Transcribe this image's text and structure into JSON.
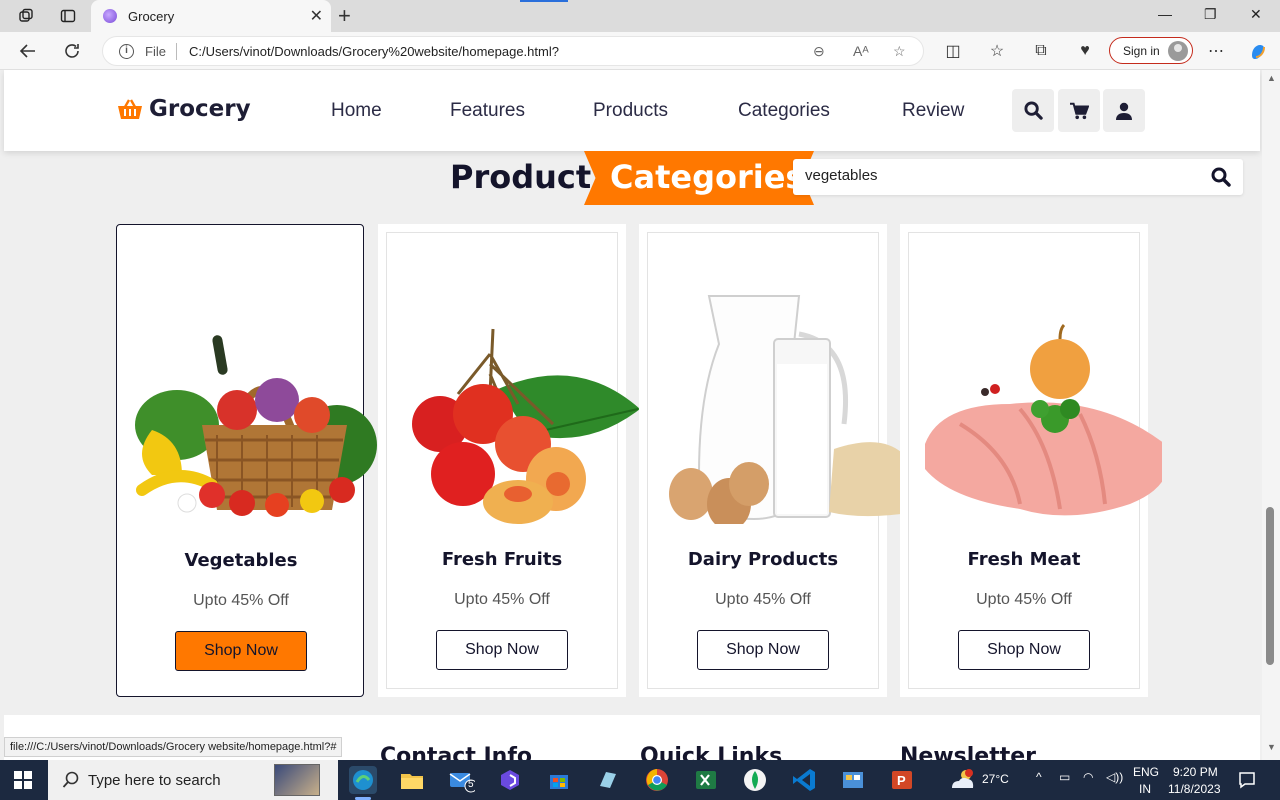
{
  "browser": {
    "tab_title": "Grocery",
    "address_scheme": "File",
    "address_url": "C:/Users/vinot/Downloads/Grocery%20website/homepage.html?",
    "signin_label": "Sign in",
    "status_url": "file:///C:/Users/vinot/Downloads/Grocery website/homepage.html?#"
  },
  "site": {
    "logo_text": "Grocery",
    "nav": [
      "Home",
      "Features",
      "Products",
      "Categories",
      "Review"
    ],
    "section_title_1": "Product",
    "section_title_2": "Categories",
    "search_value": "vegetables",
    "categories": [
      {
        "title": "Vegetables",
        "offer": "Upto 45% Off",
        "button": "Shop Now",
        "active": true
      },
      {
        "title": "Fresh Fruits",
        "offer": "Upto 45% Off",
        "button": "Shop Now",
        "active": false
      },
      {
        "title": "Dairy Products",
        "offer": "Upto 45% Off",
        "button": "Shop Now",
        "active": false
      },
      {
        "title": "Fresh Meat",
        "offer": "Upto 45% Off",
        "button": "Shop Now",
        "active": false
      }
    ],
    "footer_headings": [
      "Contact Info",
      "Quick Links",
      "Newsletter"
    ],
    "accent_color": "#ff7800",
    "dark_color": "#14142b"
  },
  "taskbar": {
    "search_placeholder": "Type here to search",
    "mail_badge": "5",
    "weather": "27°C",
    "lang_1": "ENG",
    "lang_2": "IN",
    "time": "9:20 PM",
    "date": "11/8/2023"
  }
}
